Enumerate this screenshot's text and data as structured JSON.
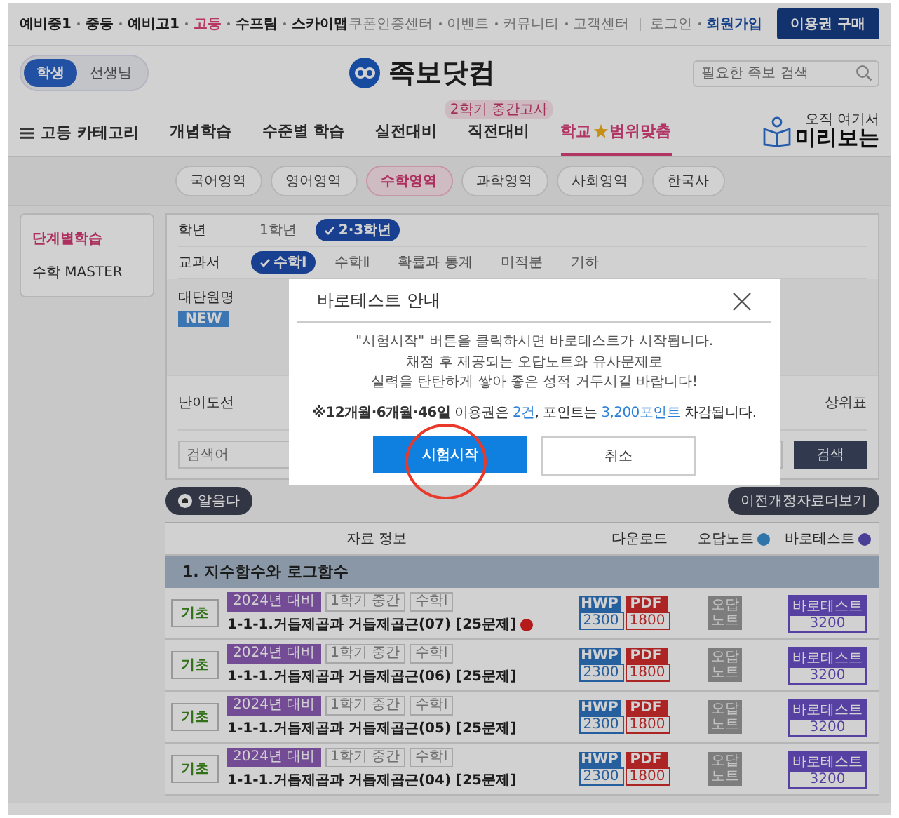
{
  "top_bar": {
    "levels": [
      {
        "label": "예비중1",
        "selected": false
      },
      {
        "label": "중등",
        "selected": false
      },
      {
        "label": "예비고1",
        "selected": false
      },
      {
        "label": "고등",
        "selected": true
      },
      {
        "label": "수프림",
        "selected": false
      },
      {
        "label": "스카이맵",
        "selected": false
      }
    ],
    "links": [
      "쿠폰인증센터",
      "이벤트",
      "커뮤니티",
      "고객센터"
    ],
    "login": "로그인",
    "signup": "회원가입",
    "buy_button": "이용권 구매"
  },
  "role_toggle": [
    {
      "label": "학생",
      "selected": true
    },
    {
      "label": "선생님",
      "selected": false
    }
  ],
  "logo": "족보닷컴",
  "search": {
    "placeholder": "필요한 족보 검색"
  },
  "nav": {
    "category": "고등 카테고리",
    "items": [
      {
        "label": "개념학습",
        "selected": false
      },
      {
        "label": "수준별 학습",
        "selected": false
      },
      {
        "label": "실전대비",
        "selected": false
      },
      {
        "label": "직전대비",
        "selected": false,
        "badge": "2학기 중간고사"
      },
      {
        "label": "학교",
        "label_after": "범위맞춤",
        "selected": true
      }
    ],
    "promo": [
      "오직 여기서",
      "미리보는"
    ]
  },
  "subjects": [
    {
      "label": "국어영역",
      "selected": false
    },
    {
      "label": "영어영역",
      "selected": false
    },
    {
      "label": "수학영역",
      "selected": true
    },
    {
      "label": "과학영역",
      "selected": false
    },
    {
      "label": "사회영역",
      "selected": false
    },
    {
      "label": "한국사",
      "selected": false
    }
  ],
  "sidebar": {
    "items": [
      {
        "label": "단계별학습",
        "selected": true
      },
      {
        "label": "수학 MASTER",
        "selected": false
      }
    ]
  },
  "filters": {
    "grade": {
      "label": "학년",
      "options": [
        {
          "label": "1학년",
          "selected": false
        },
        {
          "label": "2·3학년",
          "selected": true
        }
      ]
    },
    "textbook": {
      "label": "교과서",
      "options": [
        {
          "label": "수학Ⅰ",
          "selected": true
        },
        {
          "label": "수학Ⅱ",
          "selected": false
        },
        {
          "label": "확률과 통계",
          "selected": false
        },
        {
          "label": "미적분",
          "selected": false
        },
        {
          "label": "기하",
          "selected": false
        }
      ]
    },
    "unit": {
      "label": "대단원명",
      "badge": "NEW"
    },
    "difficulty": {
      "label": "난이도선",
      "right_text": "상위표"
    },
    "search": {
      "placeholder": "검색어",
      "button": "검색"
    }
  },
  "actions": {
    "left_button": "알음다",
    "right_button": "이전개정자료더보기"
  },
  "table": {
    "columns": [
      {
        "label": "자료 정보",
        "help": false
      },
      {
        "label": "다운로드",
        "help": false
      },
      {
        "label": "오답노트",
        "help": true
      },
      {
        "label": "바로테스트",
        "help": true
      }
    ],
    "section": "1. 지수함수와 로그함수",
    "rows": [
      {
        "level": "기초",
        "tags": [
          "2024년 대비",
          "1학기 중간",
          "수학Ⅰ"
        ],
        "title": "1-1-1.거듭제곱과 거듭제곱근(07) [25문제]",
        "new_mark": true,
        "hwp": "HWP",
        "hwp_price": "2300",
        "pdf": "PDF",
        "pdf_price": "1800",
        "note": "오답 노트",
        "test": "바로테스트",
        "test_price": "3200"
      },
      {
        "level": "기초",
        "tags": [
          "2024년 대비",
          "1학기 중간",
          "수학Ⅰ"
        ],
        "title": "1-1-1.거듭제곱과 거듭제곱근(06) [25문제]",
        "new_mark": false,
        "hwp": "HWP",
        "hwp_price": "2300",
        "pdf": "PDF",
        "pdf_price": "1800",
        "note": "오답 노트",
        "test": "바로테스트",
        "test_price": "3200"
      },
      {
        "level": "기초",
        "tags": [
          "2024년 대비",
          "1학기 중간",
          "수학Ⅰ"
        ],
        "title": "1-1-1.거듭제곱과 거듭제곱근(05) [25문제]",
        "new_mark": false,
        "hwp": "HWP",
        "hwp_price": "2300",
        "pdf": "PDF",
        "pdf_price": "1800",
        "note": "오답 노트",
        "test": "바로테스트",
        "test_price": "3200"
      },
      {
        "level": "기초",
        "tags": [
          "2024년 대비",
          "1학기 중간",
          "수학Ⅰ"
        ],
        "title": "1-1-1.거듭제곱과 거듭제곱근(04) [25문제]",
        "new_mark": false,
        "hwp": "HWP",
        "hwp_price": "2300",
        "pdf": "PDF",
        "pdf_price": "1800",
        "note": "오답 노트",
        "test": "바로테스트",
        "test_price": "3200"
      }
    ]
  },
  "modal": {
    "title": "바로테스트 안내",
    "lines": [
      "\"시험시작\" 버튼을 클릭하시면 바로테스트가 시작됩니다.",
      "채점 후 제공되는 오답노트와 유사문제로",
      "실력을 탄탄하게 쌓아 좋은 성적 거두시길 바랍니다!"
    ],
    "notice": [
      {
        "text": "※12개월·6개월·46일",
        "kind": "bold"
      },
      {
        "text": " 이용권은 ",
        "kind": "plain"
      },
      {
        "text": "2건",
        "kind": "highlight"
      },
      {
        "text": ", 포인트는 ",
        "kind": "plain"
      },
      {
        "text": "3,200포인트",
        "kind": "highlight"
      },
      {
        "text": " 차감됩니다.",
        "kind": "plain"
      }
    ],
    "buttons": [
      {
        "label": "시험시작",
        "kind": "primary",
        "highlighted": true
      },
      {
        "label": "취소",
        "kind": "secondary",
        "highlighted": false
      }
    ]
  }
}
